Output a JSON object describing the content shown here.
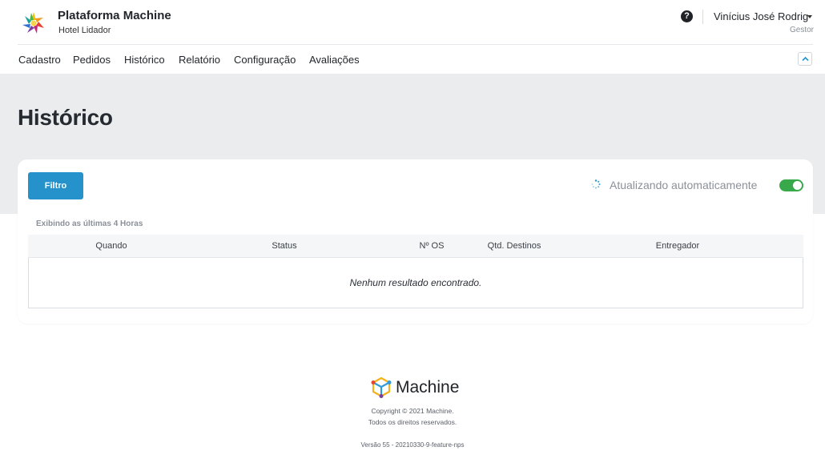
{
  "header": {
    "brand_title": "Plataforma Machine",
    "brand_subtitle": "Hotel Lidador",
    "help_icon": "question-circle-icon",
    "user_name": "Vinícius José Rodrig",
    "user_role": "Gestor"
  },
  "nav": {
    "items": [
      {
        "label": "Cadastro"
      },
      {
        "label": "Pedidos"
      },
      {
        "label": "Histórico"
      },
      {
        "label": "Relatório"
      },
      {
        "label": "Configuração"
      },
      {
        "label": "Avaliações"
      }
    ],
    "collapse_icon": "chevron-up-icon"
  },
  "page": {
    "title": "Histórico"
  },
  "card": {
    "filter_button": "Filtro",
    "auto_refresh_label": "Atualizando automaticamente",
    "auto_refresh_on": true,
    "showing_label": "Exibindo as últimas 4 Horas",
    "columns": [
      "Quando",
      "Status",
      "Nº OS",
      "Qtd. Destinos",
      "Entregador"
    ],
    "empty_message": "Nenhum resultado encontrado."
  },
  "footer": {
    "brand": "Machine",
    "copyright": "Copyright © 2021 Machine.",
    "rights": "Todos os direitos reservados.",
    "version": "Versão 55 - 20210330-9-feature-nps"
  },
  "colors": {
    "primary": "#2592cc",
    "toggle_on": "#38a94a",
    "band": "#ebecee"
  }
}
